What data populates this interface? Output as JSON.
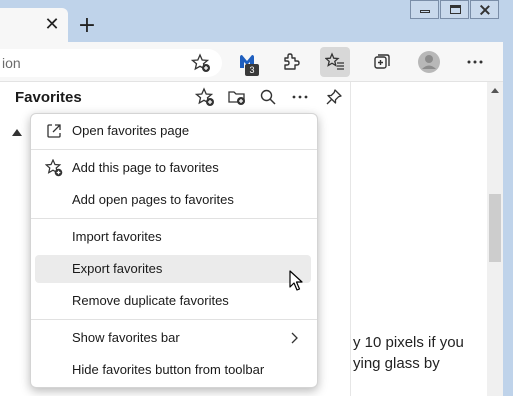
{
  "window": {
    "tab_close_glyph": "✕",
    "new_tab_glyph": "+",
    "controls": [
      "minimize-icon",
      "maximize-icon",
      "close-icon"
    ]
  },
  "toolbar": {
    "address_text": "ion",
    "extension_badge": "3",
    "icons": [
      "add-favorite-icon",
      "malwarebytes-icon",
      "extensions-icon",
      "favorites-icon",
      "collections-icon",
      "profile-icon",
      "more-icon"
    ]
  },
  "favorites_panel": {
    "title": "Favorites",
    "icons": [
      "add-this-page-icon",
      "add-folder-icon",
      "search-icon",
      "more-options-icon",
      "pin-icon"
    ]
  },
  "context_menu": {
    "items": [
      {
        "label": "Open favorites page",
        "icon": "open-external-icon"
      },
      {
        "label": "Add this page to favorites",
        "icon": "star-add-icon"
      },
      {
        "label": "Add open pages to favorites",
        "icon": ""
      },
      {
        "label": "Import favorites",
        "icon": ""
      },
      {
        "label": "Export favorites",
        "icon": "",
        "hovered": true
      },
      {
        "label": "Remove duplicate favorites",
        "icon": ""
      },
      {
        "label": "Show favorites bar",
        "icon": "",
        "submenu": true
      },
      {
        "label": "Hide favorites button from toolbar",
        "icon": ""
      }
    ]
  },
  "page": {
    "line1": "y 10 pixels if you",
    "line2": "ying glass by"
  }
}
